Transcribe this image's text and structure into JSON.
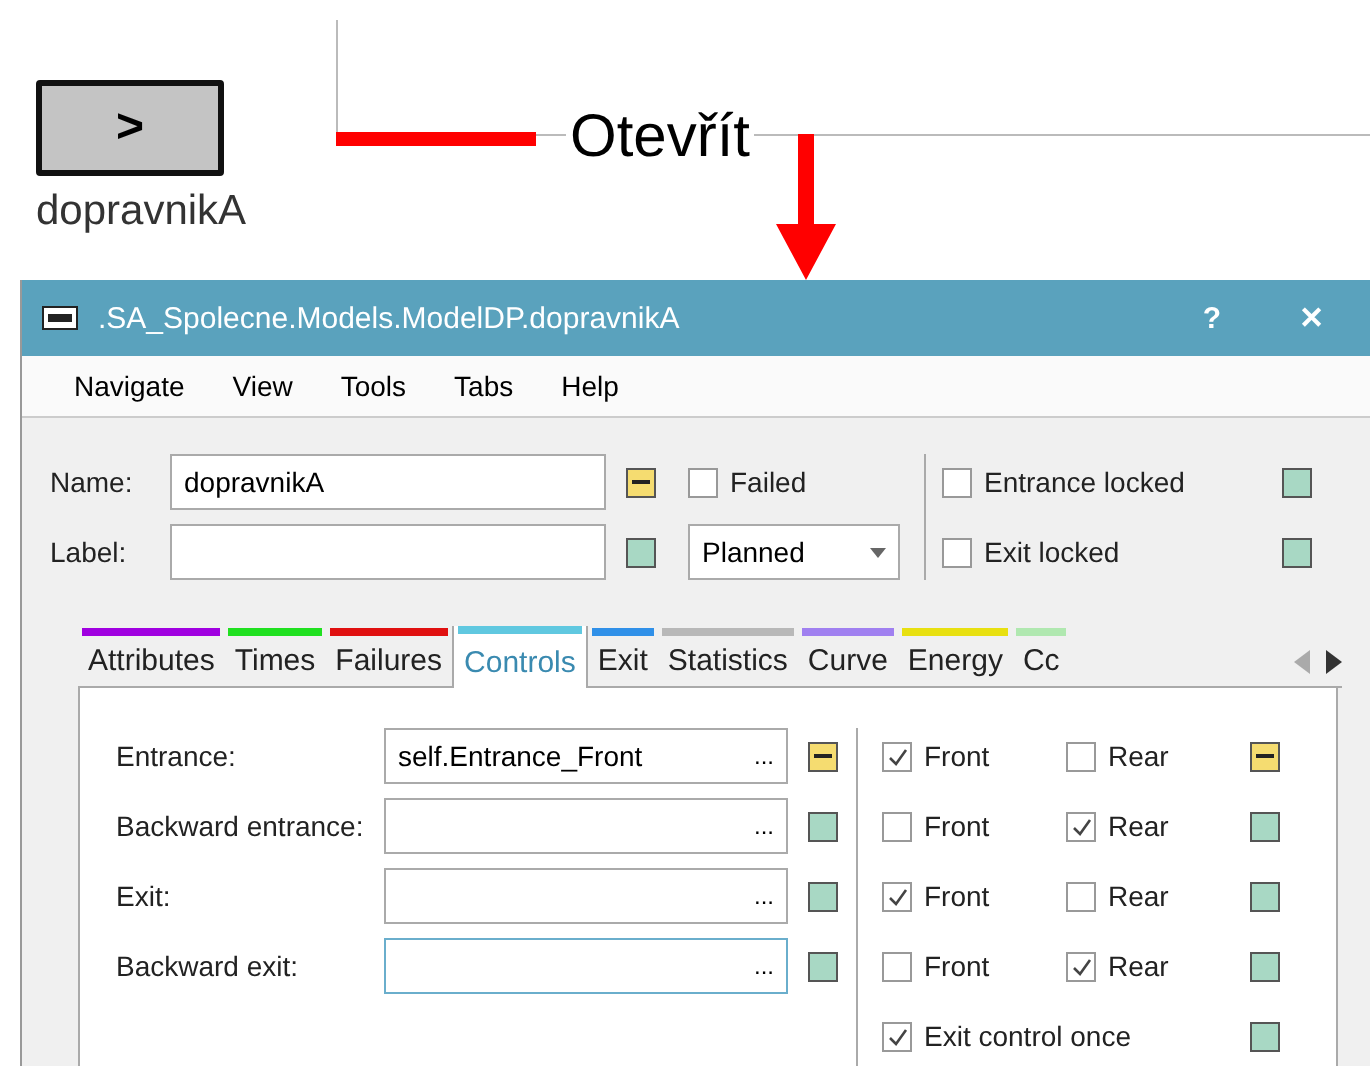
{
  "block": {
    "glyph": ">",
    "label": "dopravnikA"
  },
  "annotation": {
    "label": "Otevřít"
  },
  "window": {
    "title": ".SA_Spolecne.Models.ModelDP.dopravnikA",
    "help": "?",
    "close": "✕"
  },
  "menu": [
    "Navigate",
    "View",
    "Tools",
    "Tabs",
    "Help"
  ],
  "header": {
    "name": {
      "label": "Name:",
      "value": "dopravnikA",
      "modified": true
    },
    "label": {
      "label": "Label:",
      "modified": false
    },
    "failed": {
      "label": "Failed",
      "checked": false
    },
    "state": {
      "value": "Planned"
    },
    "locks": [
      {
        "label": "Entrance locked",
        "checked": false,
        "modified": false
      },
      {
        "label": "Exit locked",
        "checked": false,
        "modified": false
      }
    ]
  },
  "tabs": [
    {
      "label": "Attributes",
      "color": "#a000e0",
      "selected": false
    },
    {
      "label": "Times",
      "color": "#20e020",
      "selected": false
    },
    {
      "label": "Failures",
      "color": "#e01010",
      "selected": false
    },
    {
      "label": "Controls",
      "color": "#60c8e0",
      "selected": true
    },
    {
      "label": "Exit",
      "color": "#3090e8",
      "selected": false
    },
    {
      "label": "Statistics",
      "color": "#b8b8b8",
      "selected": false
    },
    {
      "label": "Curve",
      "color": "#a080f0",
      "selected": false
    },
    {
      "label": "Energy",
      "color": "#e8e010",
      "selected": false
    },
    {
      "label": "Cc",
      "color": "#b0e8b0",
      "selected": false
    }
  ],
  "controls": [
    {
      "label": "Entrance:",
      "value": "self.Entrance_Front",
      "browse": "...",
      "focused": false,
      "modified": true,
      "front": {
        "label": "Front",
        "checked": true
      },
      "rear": {
        "label": "Rear",
        "checked": false
      },
      "side_modified": true
    },
    {
      "label": "Backward entrance:",
      "browse": "...",
      "focused": false,
      "modified": false,
      "front": {
        "label": "Front",
        "checked": false
      },
      "rear": {
        "label": "Rear",
        "checked": true
      },
      "side_modified": false
    },
    {
      "label": "Exit:",
      "browse": "...",
      "focused": false,
      "modified": false,
      "front": {
        "label": "Front",
        "checked": true
      },
      "rear": {
        "label": "Rear",
        "checked": false
      },
      "side_modified": false
    },
    {
      "label": "Backward exit:",
      "browse": "...",
      "focused": true,
      "modified": false,
      "front": {
        "label": "Front",
        "checked": false
      },
      "rear": {
        "label": "Rear",
        "checked": true
      },
      "side_modified": false
    }
  ],
  "exit_control_once": {
    "label": "Exit control once",
    "checked": true,
    "modified": false
  }
}
